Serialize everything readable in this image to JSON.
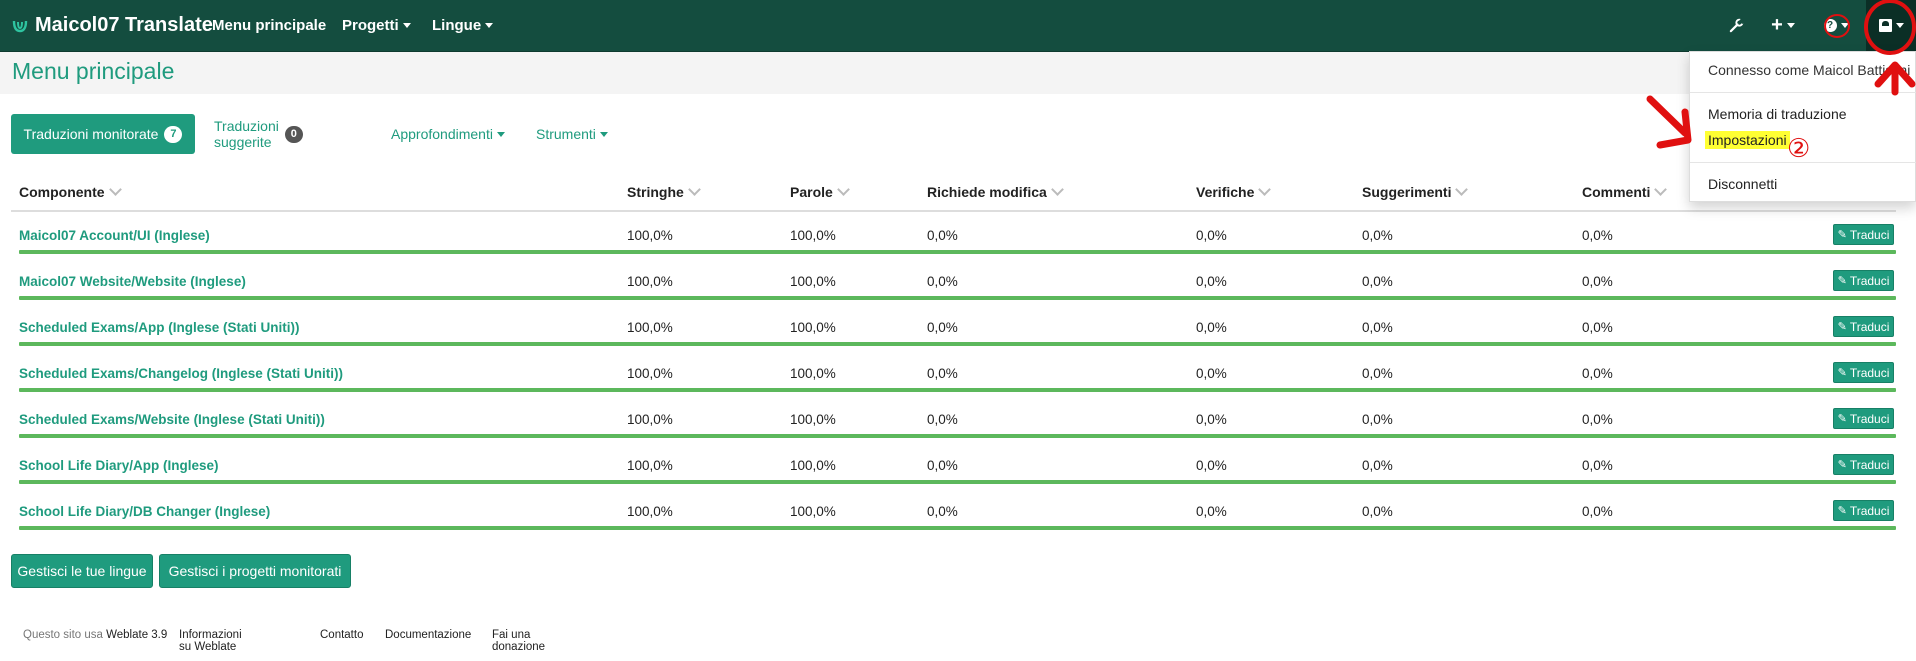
{
  "navbar": {
    "brand": "Maicol07 Translate",
    "links": [
      {
        "label": "Menu principale"
      },
      {
        "label": "Progetti"
      },
      {
        "label": "Lingue"
      }
    ],
    "icons": {
      "tools": "wrench-icon",
      "add": "plus-icon",
      "help": "question-icon",
      "user": "user-avatar-icon"
    }
  },
  "page": {
    "title": "Menu principale"
  },
  "tabs": [
    {
      "label": "Traduzioni monitorate",
      "badge": "7",
      "active": true
    },
    {
      "label": "Traduzioni suggerite",
      "badge": "0"
    },
    {
      "label": "Approfondimenti"
    },
    {
      "label": "Strumenti"
    }
  ],
  "table": {
    "headers": [
      "Componente",
      "Stringhe",
      "Parole",
      "Richiede modifica",
      "Verifiche",
      "Suggerimenti",
      "Commenti"
    ],
    "action_label": "Traduci",
    "rows": [
      {
        "name": "Maicol07 Account/UI (Inglese)",
        "stringhe": "100,0%",
        "parole": "100,0%",
        "richiede": "0,0%",
        "verifiche": "0,0%",
        "suggerimenti": "0,0%",
        "commenti": "0,0%"
      },
      {
        "name": "Maicol07 Website/Website (Inglese)",
        "stringhe": "100,0%",
        "parole": "100,0%",
        "richiede": "0,0%",
        "verifiche": "0,0%",
        "suggerimenti": "0,0%",
        "commenti": "0,0%"
      },
      {
        "name": "Scheduled Exams/App (Inglese (Stati Uniti))",
        "stringhe": "100,0%",
        "parole": "100,0%",
        "richiede": "0,0%",
        "verifiche": "0,0%",
        "suggerimenti": "0,0%",
        "commenti": "0,0%"
      },
      {
        "name": "Scheduled Exams/Changelog (Inglese (Stati Uniti))",
        "stringhe": "100,0%",
        "parole": "100,0%",
        "richiede": "0,0%",
        "verifiche": "0,0%",
        "suggerimenti": "0,0%",
        "commenti": "0,0%"
      },
      {
        "name": "Scheduled Exams/Website (Inglese (Stati Uniti))",
        "stringhe": "100,0%",
        "parole": "100,0%",
        "richiede": "0,0%",
        "verifiche": "0,0%",
        "suggerimenti": "0,0%",
        "commenti": "0,0%"
      },
      {
        "name": "School Life Diary/App (Inglese)",
        "stringhe": "100,0%",
        "parole": "100,0%",
        "richiede": "0,0%",
        "verifiche": "0,0%",
        "suggerimenti": "0,0%",
        "commenti": "0,0%"
      },
      {
        "name": "School Life Diary/DB Changer (Inglese)",
        "stringhe": "100,0%",
        "parole": "100,0%",
        "richiede": "0,0%",
        "verifiche": "0,0%",
        "suggerimenti": "0,0%",
        "commenti": "0,0%"
      }
    ]
  },
  "buttons": {
    "manage_languages": "Gestisci le tue lingue",
    "manage_projects": "Gestisci i progetti monitorati"
  },
  "footer": {
    "powered_prefix": "Questo sito usa",
    "powered_link": "Weblate 3.9",
    "links": [
      "Informazioni su Weblate",
      "Contatto",
      "Documentazione",
      "Fai una donazione"
    ]
  },
  "user_menu": {
    "logged_in_as": "Connesso come Maicol Battistini",
    "items": [
      "Memoria di traduzione",
      "Impostazioni",
      "Disconnetti"
    ]
  },
  "annotations": {
    "step_two": "②"
  },
  "colors": {
    "navbar": "#144d3f",
    "accent": "#1f9b7e",
    "progress": "#5cb85c",
    "highlight": "#ffff33",
    "annotation": "#e01010"
  }
}
